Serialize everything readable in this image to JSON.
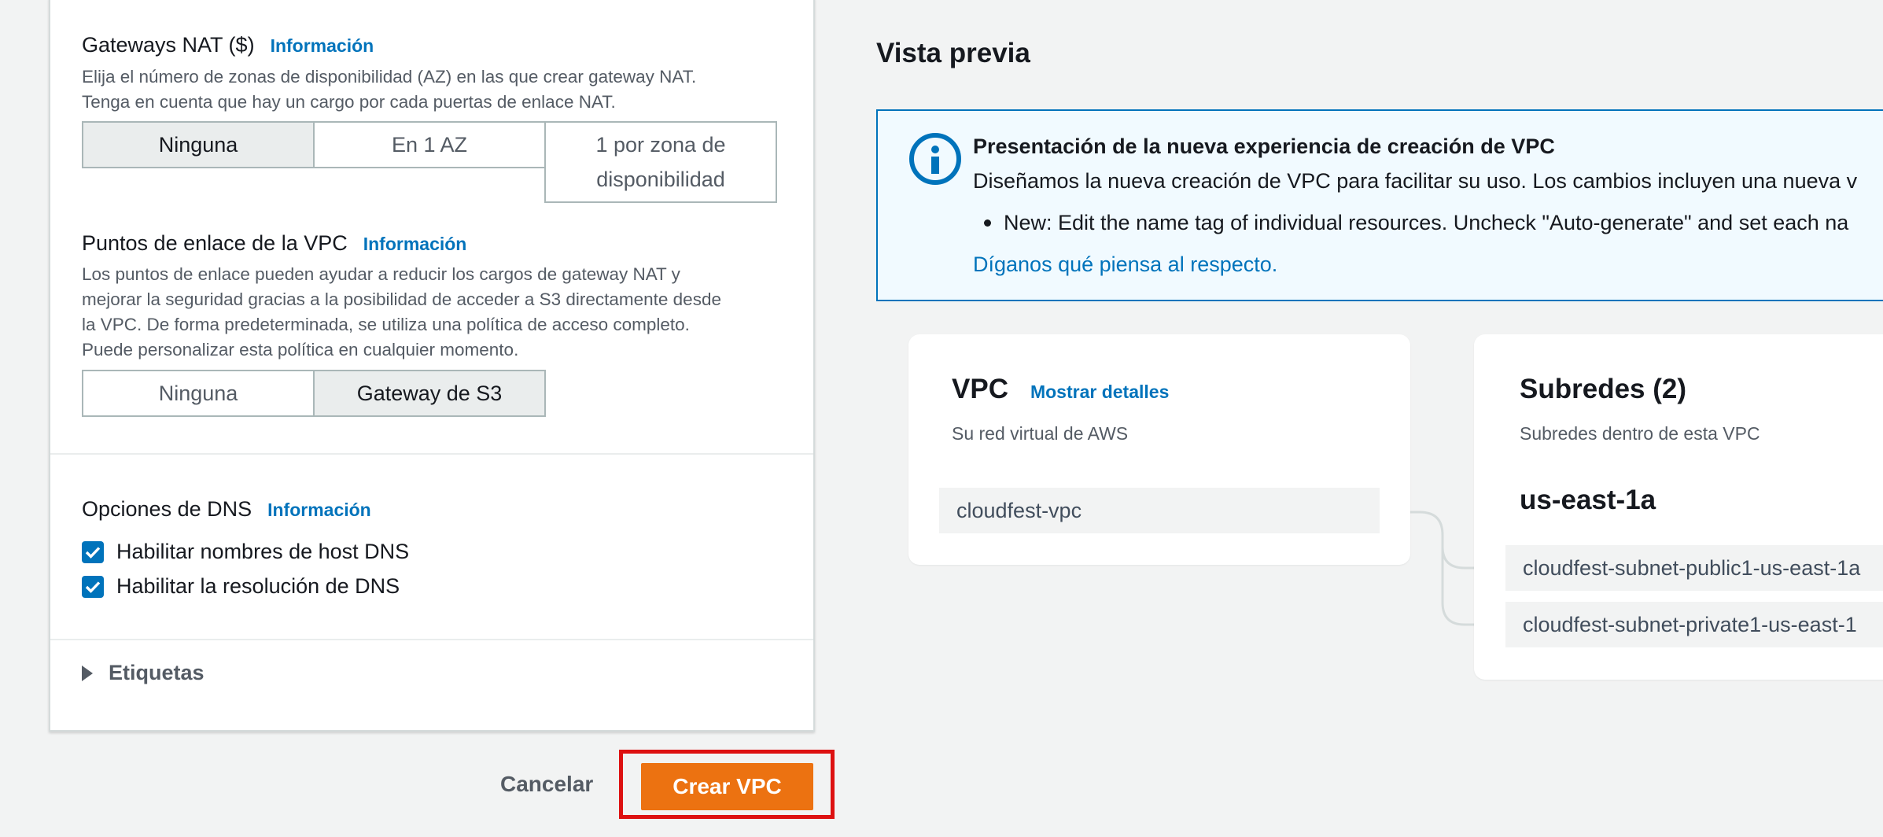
{
  "nat": {
    "title": "Gateways NAT ($)",
    "info": "Información",
    "desc_line1": "Elija el número de zonas de disponibilidad (AZ) en las que crear gateway NAT.",
    "desc_line2": "Tenga en cuenta que hay un cargo por cada puertas de enlace NAT.",
    "options": [
      "Ninguna",
      "En 1 AZ",
      "1 por zona de disponibilidad"
    ],
    "selected": "Ninguna"
  },
  "endpoints": {
    "title": "Puntos de enlace de la VPC",
    "info": "Información",
    "desc_lines": [
      "Los puntos de enlace pueden ayudar a reducir los cargos de gateway NAT y",
      "mejorar la seguridad gracias a la posibilidad de acceder a S3 directamente desde",
      "la VPC. De forma predeterminada, se utiliza una política de acceso completo.",
      "Puede personalizar esta política en cualquier momento."
    ],
    "options": [
      "Ninguna",
      "Gateway de S3"
    ],
    "selected": "Gateway de S3"
  },
  "dns": {
    "title": "Opciones de DNS",
    "info": "Información",
    "options": [
      {
        "label": "Habilitar nombres de host DNS",
        "checked": true
      },
      {
        "label": "Habilitar la resolución de DNS",
        "checked": true
      }
    ]
  },
  "tags": {
    "label": "Etiquetas"
  },
  "actions": {
    "cancel": "Cancelar",
    "create": "Crear VPC"
  },
  "preview": {
    "title": "Vista previa",
    "flash": {
      "heading": "Presentación de la nueva experiencia de creación de VPC",
      "body": "Diseñamos la nueva creación de VPC para facilitar su uso. Los cambios incluyen una nueva v",
      "bullet": "New: Edit the name tag of individual resources. Uncheck \"Auto-generate\" and set each na",
      "link": "Díganos qué piensa al respecto."
    },
    "vpc": {
      "title": "VPC",
      "link": "Mostrar detalles",
      "subtitle": "Su red virtual de AWS",
      "resource": "cloudfest-vpc"
    },
    "subnets": {
      "title": "Subredes (2)",
      "subtitle": "Subredes dentro de esta VPC",
      "az": "us-east-1a",
      "items": [
        "cloudfest-subnet-public1-us-east-1a",
        "cloudfest-subnet-private1-us-east-1"
      ]
    }
  },
  "colors": {
    "accent": "#0073bb",
    "primary_button": "#ec7211",
    "highlight": "#dd1111"
  }
}
